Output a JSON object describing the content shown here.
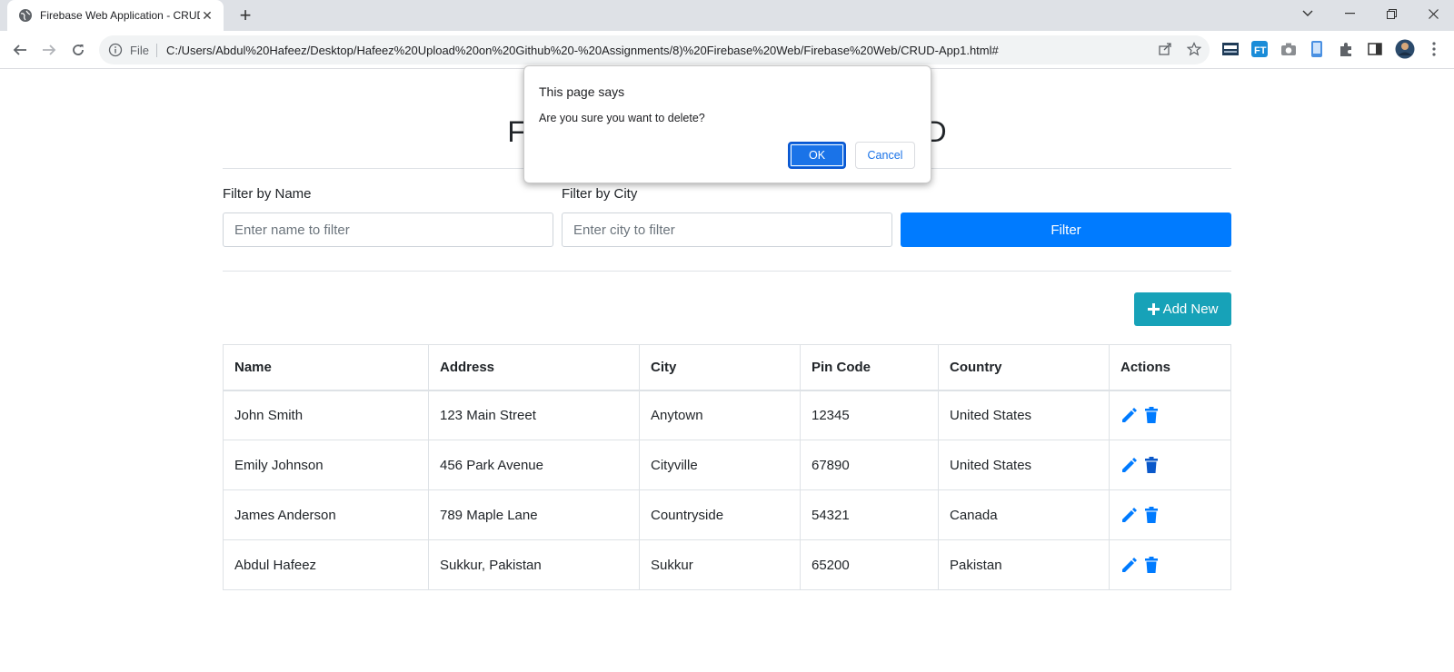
{
  "browser": {
    "tab_title": "Firebase Web Application - CRUD",
    "file_label": "File",
    "url": "C:/Users/Abdul%20Hafeez/Desktop/Hafeez%20Upload%20on%20Github%20-%20Assignments/8)%20Firebase%20Web/Firebase%20Web/CRUD-App1.html#"
  },
  "page": {
    "heading": "Firebase Web Application - CRUD"
  },
  "filters": {
    "name_label": "Filter by Name",
    "name_placeholder": "Enter name to filter",
    "city_label": "Filter by City",
    "city_placeholder": "Enter city to filter",
    "filter_button": "Filter"
  },
  "add_new_label": "Add New",
  "table": {
    "headers": [
      "Name",
      "Address",
      "City",
      "Pin Code",
      "Country",
      "Actions"
    ],
    "rows": [
      [
        "John Smith",
        "123 Main Street",
        "Anytown",
        "12345",
        "United States"
      ],
      [
        "Emily Johnson",
        "456 Park Avenue",
        "Cityville",
        "67890",
        "United States"
      ],
      [
        "James Anderson",
        "789 Maple Lane",
        "Countryside",
        "54321",
        "Canada"
      ],
      [
        "Abdul Hafeez",
        "Sukkur, Pakistan",
        "Sukkur",
        "65200",
        "Pakistan"
      ]
    ]
  },
  "dialog": {
    "title": "This page says",
    "message": "Are you sure you want to delete?",
    "ok_label": "OK",
    "cancel_label": "Cancel"
  },
  "colors": {
    "primary": "#007bff",
    "info": "#17a2b8",
    "dialog_ok": "#1a73e8"
  }
}
